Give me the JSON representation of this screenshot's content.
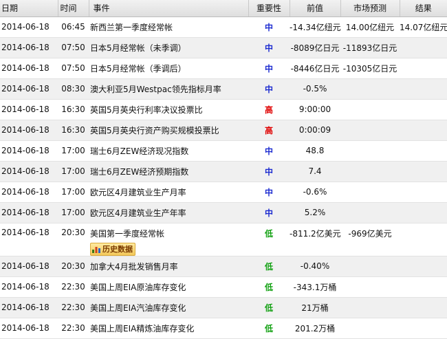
{
  "columns": {
    "date": "日期",
    "time": "时间",
    "event": "事件",
    "importance": "重要性",
    "previous": "前值",
    "forecast": "市场预测",
    "actual": "结果"
  },
  "history_button_label": "历史数据",
  "importance_colors": {
    "高": "#e00000",
    "中": "#1b2ad0",
    "低": "#10a010"
  },
  "rows": [
    {
      "date": "2014-06-18",
      "time": "06:45",
      "event": "新西兰第一季度经常帐",
      "importance": "中",
      "previous": "-14.34亿纽元",
      "forecast": "14.00亿纽元",
      "actual": "14.07亿纽元"
    },
    {
      "date": "2014-06-18",
      "time": "07:50",
      "event": "日本5月经常帐（未季调）",
      "importance": "中",
      "previous": "-8089亿日元",
      "forecast": "-11893亿日元",
      "actual": ""
    },
    {
      "date": "2014-06-18",
      "time": "07:50",
      "event": "日本5月经常帐（季调后）",
      "importance": "中",
      "previous": "-8446亿日元",
      "forecast": "-10305亿日元",
      "actual": ""
    },
    {
      "date": "2014-06-18",
      "time": "08:30",
      "event": "澳大利亚5月Westpac领先指标月率",
      "importance": "中",
      "previous": "-0.5%",
      "forecast": "",
      "actual": ""
    },
    {
      "date": "2014-06-18",
      "time": "16:30",
      "event": "英国5月英央行利率决议投票比",
      "importance": "高",
      "previous": "9:00:00",
      "forecast": "",
      "actual": ""
    },
    {
      "date": "2014-06-18",
      "time": "16:30",
      "event": "英国5月英央行资产购买规模投票比",
      "importance": "高",
      "previous": "0:00:09",
      "forecast": "",
      "actual": ""
    },
    {
      "date": "2014-06-18",
      "time": "17:00",
      "event": "瑞士6月ZEW经济现况指数",
      "importance": "中",
      "previous": "48.8",
      "forecast": "",
      "actual": ""
    },
    {
      "date": "2014-06-18",
      "time": "17:00",
      "event": "瑞士6月ZEW经济预期指数",
      "importance": "中",
      "previous": "7.4",
      "forecast": "",
      "actual": ""
    },
    {
      "date": "2014-06-18",
      "time": "17:00",
      "event": "欧元区4月建筑业生产月率",
      "importance": "中",
      "previous": "-0.6%",
      "forecast": "",
      "actual": ""
    },
    {
      "date": "2014-06-18",
      "time": "17:00",
      "event": "欧元区4月建筑业生产年率",
      "importance": "中",
      "previous": "5.2%",
      "forecast": "",
      "actual": ""
    },
    {
      "date": "2014-06-18",
      "time": "20:30",
      "event": "美国第一季度经常帐",
      "importance": "低",
      "previous": "-811.2亿美元",
      "forecast": "-969亿美元",
      "actual": "",
      "history": true
    },
    {
      "date": "2014-06-18",
      "time": "20:30",
      "event": "加拿大4月批发销售月率",
      "importance": "低",
      "previous": "-0.40%",
      "forecast": "",
      "actual": ""
    },
    {
      "date": "2014-06-18",
      "time": "22:30",
      "event": "美国上周EIA原油库存变化",
      "importance": "低",
      "previous": "-343.1万桶",
      "forecast": "",
      "actual": ""
    },
    {
      "date": "2014-06-18",
      "time": "22:30",
      "event": "美国上周EIA汽油库存变化",
      "importance": "低",
      "previous": "21万桶",
      "forecast": "",
      "actual": ""
    },
    {
      "date": "2014-06-18",
      "time": "22:30",
      "event": "美国上周EIA精炼油库存变化",
      "importance": "低",
      "previous": "201.2万桶",
      "forecast": "",
      "actual": ""
    }
  ]
}
